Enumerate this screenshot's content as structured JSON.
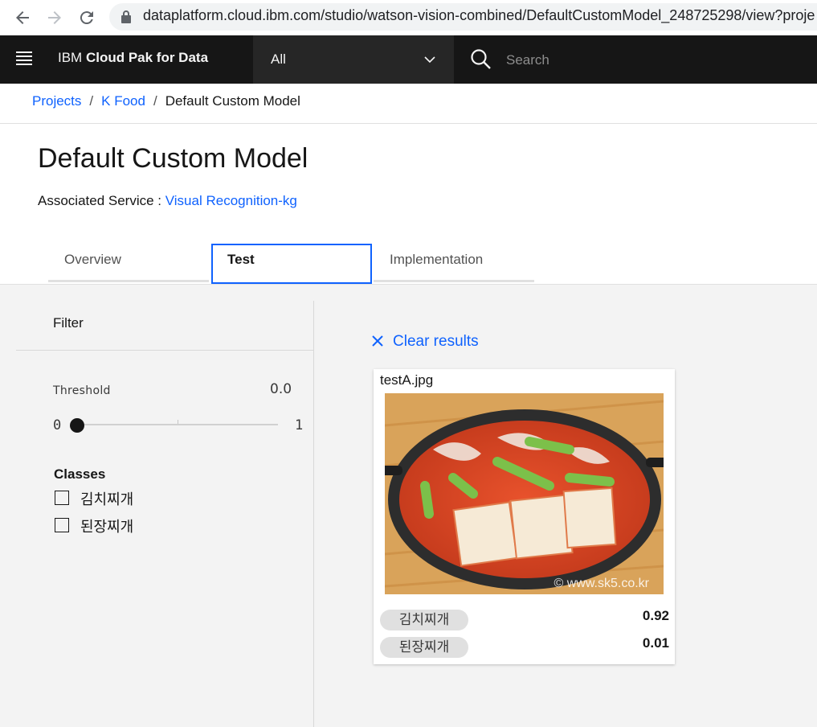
{
  "browser": {
    "url": "dataplatform.cloud.ibm.com/studio/watson-vision-combined/DefaultCustomModel_248725298/view?proje"
  },
  "header": {
    "brand_prefix": "IBM ",
    "brand_bold": "Cloud Pak for Data",
    "scope": "All",
    "search_placeholder": "Search"
  },
  "breadcrumb": {
    "items": [
      "Projects",
      "K Food"
    ],
    "current": "Default Custom Model",
    "separator": "/"
  },
  "page": {
    "title": "Default Custom Model",
    "assoc_label": "Associated Service : ",
    "assoc_link": "Visual Recognition-kg"
  },
  "tabs": [
    {
      "label": "Overview",
      "active": false
    },
    {
      "label": "Test",
      "active": true
    },
    {
      "label": "Implementation",
      "active": false
    }
  ],
  "filter": {
    "title": "Filter",
    "threshold_label": "Threshold",
    "threshold_value": "0.0",
    "slider_min": "0",
    "slider_max": "1",
    "slider_fraction": 0,
    "classes_title": "Classes",
    "classes": [
      "김치찌개",
      "된장찌개"
    ]
  },
  "results": {
    "clear_label": "Clear results",
    "card": {
      "filename": "testA.jpg",
      "watermark": "© www.sk5.co.kr",
      "scores": [
        {
          "class": "김치찌개",
          "score": "0.92"
        },
        {
          "class": "된장찌개",
          "score": "0.01"
        }
      ]
    }
  },
  "colors": {
    "accent": "#0f62fe",
    "header_bg": "#161616",
    "panel_bg": "#f3f3f3"
  }
}
